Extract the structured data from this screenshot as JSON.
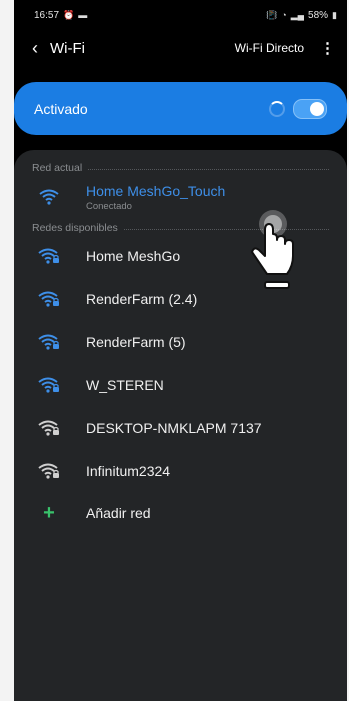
{
  "status_bar": {
    "time": "16:57",
    "left_icons": [
      "alarm-icon",
      "message-icon"
    ],
    "battery": "58%",
    "right_icons": [
      "vibrate-icon",
      "wifi-icon",
      "signal-icon",
      "battery-icon"
    ]
  },
  "appbar": {
    "title": "Wi-Fi",
    "direct_label": "Wi-Fi Directo",
    "more_icon": "kebab-menu-icon"
  },
  "toggle": {
    "label": "Activado",
    "state": "on",
    "accent": "#1b7de3"
  },
  "current_section": {
    "label": "Red actual",
    "network": {
      "name": "Home MeshGo_Touch",
      "status": "Conectado",
      "color": "#3e8fe8"
    }
  },
  "available_section": {
    "label": "Redes disponibles",
    "networks": [
      {
        "name": "Home MeshGo",
        "icon": "wifi-lock-icon",
        "color": "#3e8fe8"
      },
      {
        "name": "RenderFarm (2.4)",
        "icon": "wifi-lock-icon",
        "color": "#3e8fe8"
      },
      {
        "name": "RenderFarm (5)",
        "icon": "wifi-lock-icon",
        "color": "#3e8fe8"
      },
      {
        "name": "W_STEREN",
        "icon": "wifi-lock-icon",
        "color": "#3e8fe8"
      },
      {
        "name": "DESKTOP-NMKLAPM 7137",
        "icon": "wifi-lock-icon",
        "color": "#d0d0d0"
      },
      {
        "name": "Infinitum2324",
        "icon": "wifi-lock-icon",
        "color": "#d0d0d0"
      }
    ],
    "add_label": "Añadir red"
  },
  "overlay": {
    "icon": "tap-hand-icon"
  }
}
